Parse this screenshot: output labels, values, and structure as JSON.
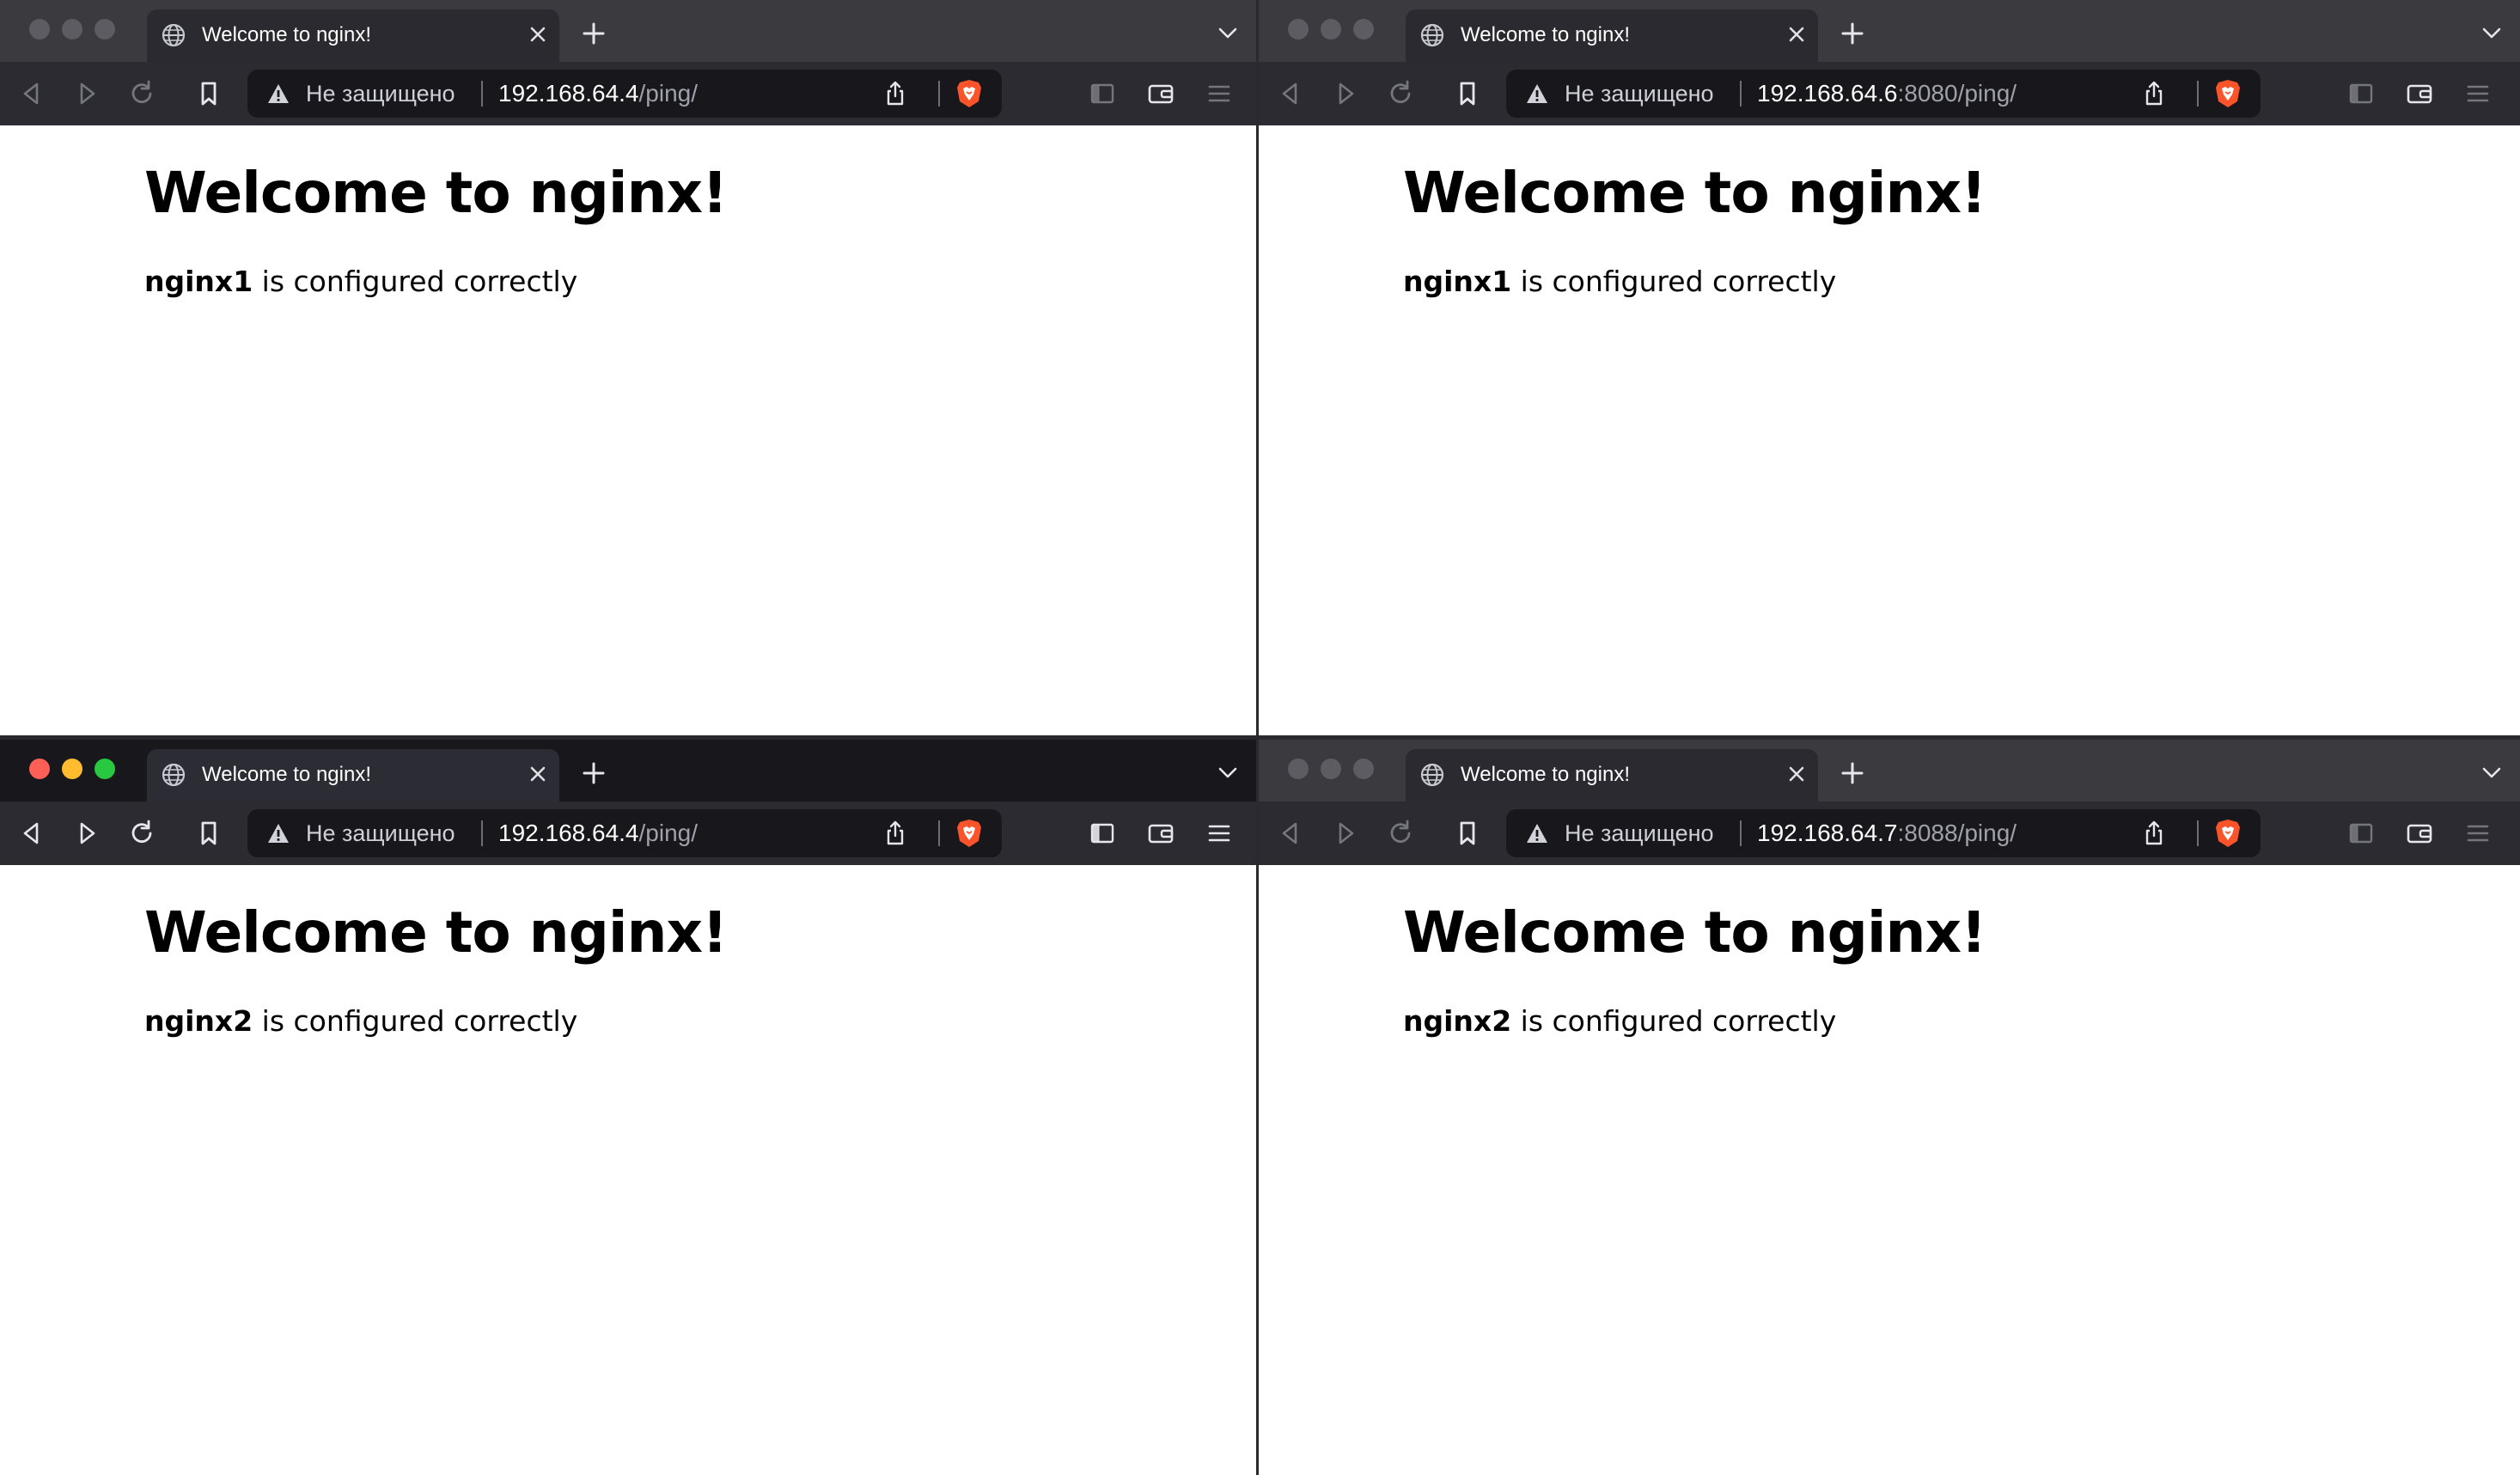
{
  "windows": [
    {
      "id": "top-left",
      "active": false,
      "tab_title": "Welcome to nginx!",
      "security_label": "Не защищено",
      "url_host": "192.168.64.4",
      "url_path": "/ping/",
      "heading": "Welcome to nginx!",
      "server_name": "nginx1",
      "message": "is configured correctly"
    },
    {
      "id": "top-right",
      "active": false,
      "tab_title": "Welcome to nginx!",
      "security_label": "Не защищено",
      "url_host": "192.168.64.6",
      "url_path": ":8080/ping/",
      "heading": "Welcome to nginx!",
      "server_name": "nginx1",
      "message": "is configured correctly"
    },
    {
      "id": "bottom-left",
      "active": true,
      "tab_title": "Welcome to nginx!",
      "security_label": "Не защищено",
      "url_host": "192.168.64.4",
      "url_path": "/ping/",
      "heading": "Welcome to nginx!",
      "server_name": "nginx2",
      "message": "is configured correctly"
    },
    {
      "id": "bottom-right",
      "active": false,
      "tab_title": "Welcome to nginx!",
      "security_label": "Не защищено",
      "url_host": "192.168.64.7",
      "url_path": ":8088/ping/",
      "heading": "Welcome to nginx!",
      "server_name": "nginx2",
      "message": "is configured correctly"
    }
  ],
  "colors": {
    "active_tabbar": "#17171c",
    "inactive_tabbar": "#3a3a3f",
    "toolbar": "#2b2b31",
    "urlbar": "#18181c",
    "brave_orange": "#fb542b",
    "traffic_red": "#fe5f57",
    "traffic_yellow": "#febc2e",
    "traffic_green": "#28c840"
  },
  "icons": [
    "globe-icon",
    "close-icon",
    "plus-icon",
    "chevron-down-icon",
    "back-icon",
    "forward-icon",
    "reload-icon",
    "bookmark-icon",
    "warning-icon",
    "share-icon",
    "brave-shield-icon",
    "sidebar-icon",
    "wallet-icon",
    "menu-icon"
  ]
}
